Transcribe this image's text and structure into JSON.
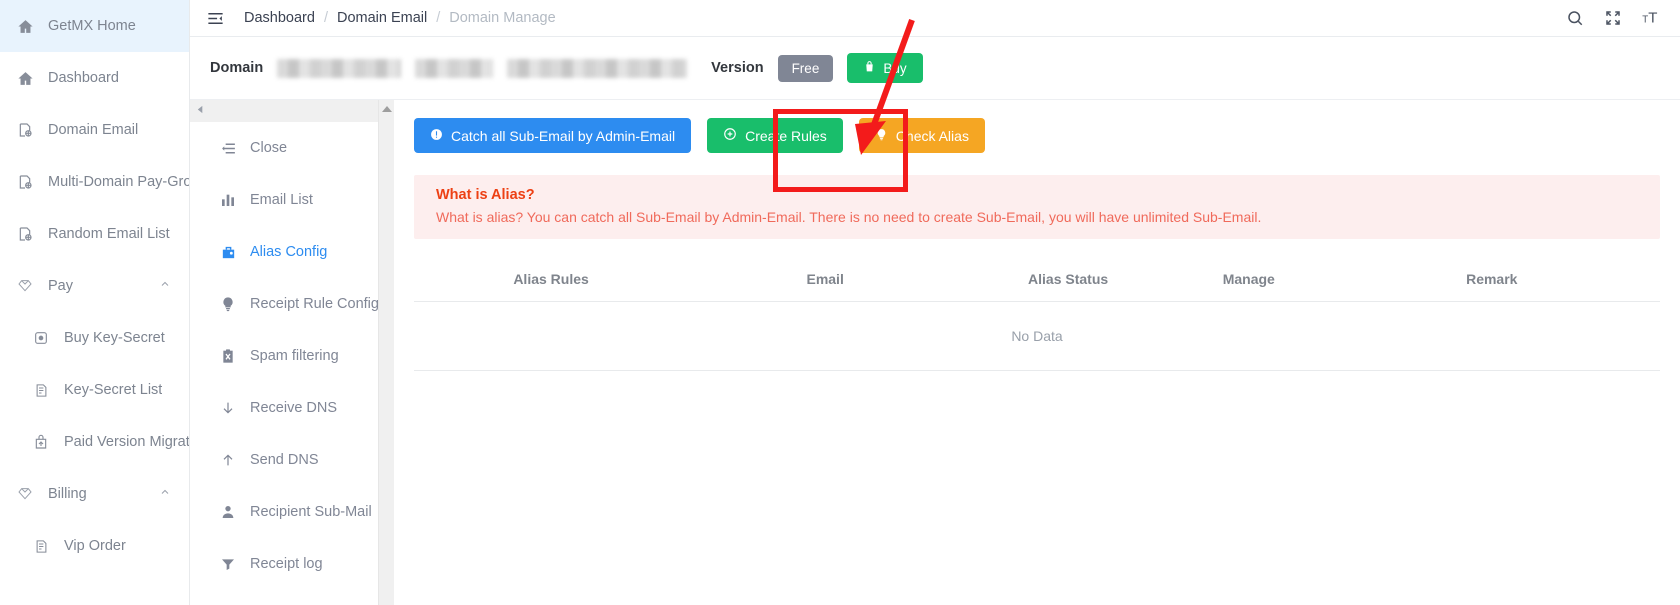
{
  "sidebar": {
    "items": [
      {
        "label": "GetMX Home",
        "icon": "home-icon",
        "active": true
      },
      {
        "label": "Dashboard",
        "icon": "home-icon",
        "active": false
      },
      {
        "label": "Domain Email",
        "icon": "domain-icon",
        "active": false
      },
      {
        "label": "Multi-Domain Pay-Group",
        "icon": "domain-icon",
        "active": false
      },
      {
        "label": "Random Email List",
        "icon": "domain-icon",
        "active": false
      },
      {
        "label": "Pay",
        "icon": "diamond-icon",
        "group": true,
        "chevron": "chevron-up-icon"
      },
      {
        "label": "Buy Key-Secret",
        "icon": "key-icon",
        "sub": true
      },
      {
        "label": "Key-Secret List",
        "icon": "list-icon",
        "sub": true
      },
      {
        "label": "Paid Version Migration",
        "icon": "upload-bag-icon",
        "sub": true
      },
      {
        "label": "Billing",
        "icon": "diamond-icon",
        "group": true,
        "chevron": "chevron-up-icon"
      },
      {
        "label": "Vip Order",
        "icon": "list-icon",
        "sub": true
      }
    ]
  },
  "header": {
    "menu_icon": "hamburger-collapse-icon",
    "breadcrumb": [
      {
        "label": "Dashboard",
        "muted": false
      },
      {
        "label": "Domain Email",
        "muted": false
      },
      {
        "label": "Domain Manage",
        "muted": true
      }
    ],
    "separator": "/",
    "icons": [
      {
        "name": "search-icon"
      },
      {
        "name": "fullscreen-icon"
      },
      {
        "name": "font-size-icon"
      }
    ]
  },
  "domain_bar": {
    "domain_label": "Domain",
    "domain_value_redacted": true,
    "version_label": "Version",
    "version_badge": "Free",
    "buy_button": "Buy",
    "buy_icon": "shopping-bag-icon"
  },
  "tabs": {
    "collapse_icon": "caret-left-icon",
    "items": [
      {
        "label": "Close",
        "icon": "close-list-icon",
        "active": false
      },
      {
        "label": "Email List",
        "icon": "bar-chart-icon",
        "active": false
      },
      {
        "label": "Alias Config",
        "icon": "briefcase-icon",
        "active": true
      },
      {
        "label": "Receipt Rule Config",
        "icon": "bulb-icon",
        "active": false
      },
      {
        "label": "Spam filtering",
        "icon": "clipboard-x-icon",
        "active": false
      },
      {
        "label": "Receive DNS",
        "icon": "arrow-down-icon",
        "active": false
      },
      {
        "label": "Send DNS",
        "icon": "arrow-up-icon",
        "active": false
      },
      {
        "label": "Recipient Sub-Mail",
        "icon": "user-icon",
        "active": false
      },
      {
        "label": "Receipt log",
        "icon": "filter-icon",
        "active": false
      }
    ]
  },
  "content": {
    "actions": [
      {
        "label": "Catch all Sub-Email by Admin-Email",
        "color": "blue",
        "icon": "info-circle-icon"
      },
      {
        "label": "Create Rules",
        "color": "green",
        "icon": "plus-circle-icon"
      },
      {
        "label": "Check Alias",
        "color": "orange",
        "icon": "bulb-icon"
      }
    ],
    "alert": {
      "title": "What is Alias?",
      "body": "What is alias? You can catch all Sub-Email by Admin-Email. There is no need to create Sub-Email, you will have unlimited Sub-Email."
    },
    "table": {
      "columns": [
        "Alias Rules",
        "Email",
        "Alias Status",
        "Manage",
        "Remark"
      ],
      "rows": [],
      "empty_text": "No Data"
    }
  },
  "annotations": {
    "highlight_box": {
      "target": "Check Alias",
      "color": "#f31b1b"
    },
    "arrow": {
      "color": "#f31b1b",
      "points_to": "Check Alias"
    }
  },
  "colors": {
    "blue": "#2d8cf0",
    "green": "#19be6b",
    "orange": "#f5a623",
    "gray": "#808695",
    "alert_red": "#ed4014",
    "annotation_red": "#f31b1b"
  }
}
